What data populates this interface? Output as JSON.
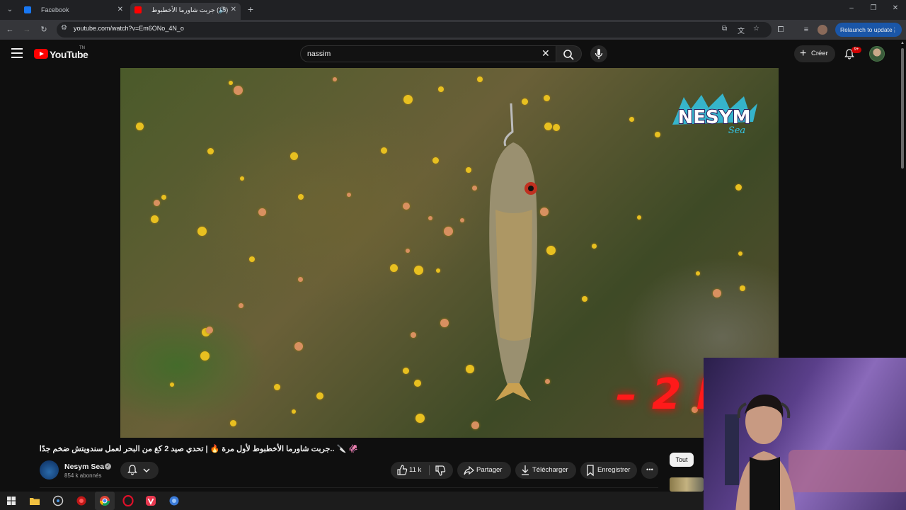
{
  "browser": {
    "tabs": [
      {
        "title": "Facebook",
        "favicon_color": "#1877f2",
        "active": false
      },
      {
        "title": "(15) جربت شاورما الأخطبوط",
        "favicon_color": "#ff0000",
        "active": true
      }
    ],
    "url": "youtube.com/watch?v=Em6ONo_4N_o",
    "relaunch_label": "Relaunch to update"
  },
  "youtube": {
    "logo_text": "YouTube",
    "logo_superscript": "TN",
    "search": {
      "query": "nassim"
    },
    "create_label": "Créer",
    "notification_count": "9+"
  },
  "video": {
    "overlay_brand": {
      "line1": "NESYM",
      "line2": "Sea"
    },
    "overlay_text": "– 2 K",
    "title": "🦑 🔪 ..جربت شاورما الأخطبوط لأول مرة 🔥 | تحدي صيد 2 كغ من البحر لعمل سندويتش ضخم جدًا",
    "channel": {
      "name": "Nesym Sea",
      "subscribers": "854 k abonnés"
    },
    "likes": "11 k",
    "actions": {
      "share": "Partager",
      "download": "Télécharger",
      "save": "Enregistrer"
    }
  },
  "sidebar_chips": {
    "all": "Tout"
  },
  "colors": {
    "accent_red": "#ff0000",
    "bg": "#0f0f0f",
    "pill_bg": "#272727",
    "relaunch_bg": "#1a56a8"
  }
}
